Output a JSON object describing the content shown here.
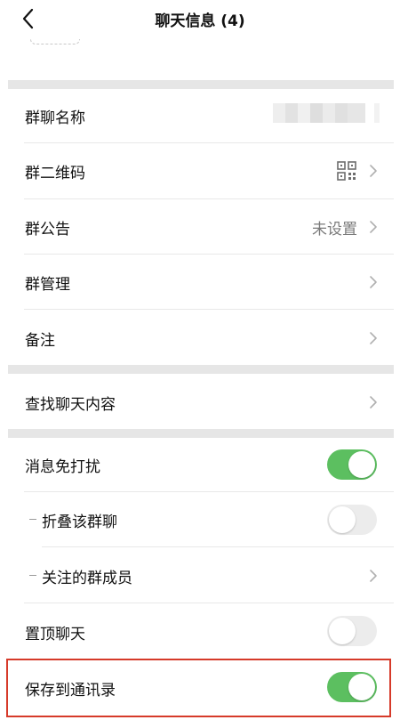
{
  "nav": {
    "title": "聊天信息 (4)"
  },
  "group": {
    "name_label": "群聊名称",
    "qr_label": "群二维码",
    "notice_label": "群公告",
    "notice_value": "未设置",
    "manage_label": "群管理",
    "remark_label": "备注"
  },
  "search": {
    "label": "查找聊天内容"
  },
  "settings": {
    "mute": {
      "label": "消息免打扰",
      "on": true
    },
    "fold": {
      "label": "折叠该群聊",
      "on": false
    },
    "focus": {
      "label": "关注的群成员"
    },
    "pin": {
      "label": "置顶聊天",
      "on": false
    },
    "save": {
      "label": "保存到通讯录",
      "on": true
    }
  },
  "colors": {
    "toggle_on": "#5cbf60",
    "highlight": "#d63a2a"
  },
  "icons": [
    "back-arrow-icon",
    "qr-code-icon",
    "chevron-right-icon"
  ]
}
